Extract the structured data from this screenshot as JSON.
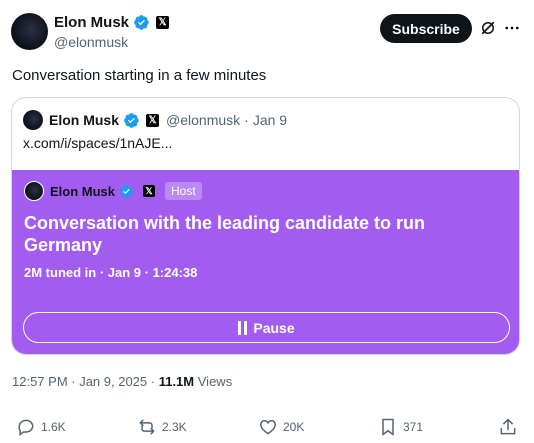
{
  "author": {
    "name": "Elon Musk",
    "handle": "@elonmusk"
  },
  "header": {
    "subscribe_label": "Subscribe"
  },
  "post": {
    "text": "Conversation starting in a few minutes"
  },
  "quote": {
    "name": "Elon Musk",
    "handle": "@elonmusk",
    "date": "Jan 9",
    "link_text": "x.com/i/spaces/1nAJE..."
  },
  "space": {
    "host_name": "Elon Musk",
    "host_badge": "Host",
    "title": "Conversation with the leading candidate to run Germany",
    "meta": "2M tuned in · Jan 9 · 1:24:38",
    "pause_label": "Pause",
    "color": "#a25cf0"
  },
  "timestamp": {
    "time": "12:57 PM · Jan 9, 2025 · ",
    "views_count": "11.1M",
    "views_label": "Views"
  },
  "actions": {
    "replies": "1.6K",
    "reposts": "2.3K",
    "likes": "20K",
    "bookmarks": "371"
  },
  "colors": {
    "verified": "#1d9bf0",
    "text": "#0f1419",
    "secondary": "#536471"
  }
}
